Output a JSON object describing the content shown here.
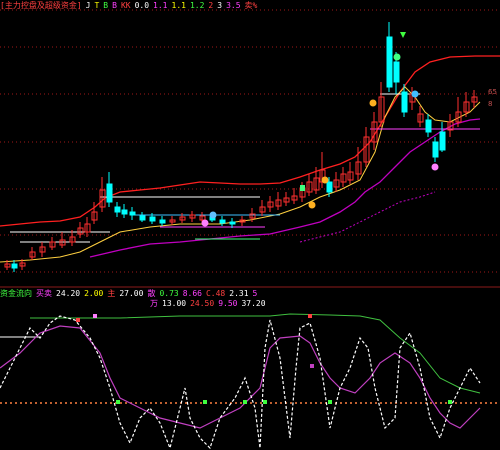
{
  "main_header": {
    "items": [
      {
        "text": "[主力控盘及超级资金]",
        "color": "#ff4040"
      },
      {
        "text": "J",
        "color": "#ffffff"
      },
      {
        "text": "T",
        "color": "#ffff00"
      },
      {
        "text": "B",
        "color": "#40ff40"
      },
      {
        "text": "B",
        "color": "#ff40ff"
      },
      {
        "text": "KK",
        "color": "#ff4040"
      },
      {
        "text": "0.0",
        "color": "#ffffff"
      },
      {
        "text": "1.1",
        "color": "#ff40ff"
      },
      {
        "text": "1.1",
        "color": "#ffff00"
      },
      {
        "text": "1.2",
        "color": "#40ff40"
      },
      {
        "text": "2",
        "color": "#ff4040"
      },
      {
        "text": "3",
        "color": "#ffffff"
      },
      {
        "text": "3.5",
        "color": "#ff40ff"
      },
      {
        "text": "卖%",
        "color": "#ff4040"
      }
    ]
  },
  "sub_header": {
    "items": [
      {
        "text": "资金流向",
        "color": "#40ff40"
      },
      {
        "text": "买卖",
        "color": "#ff40ff"
      },
      {
        "text": "24.20",
        "color": "#ffffff"
      },
      {
        "text": "2.00",
        "color": "#ffff00"
      },
      {
        "text": "主",
        "color": "#ff4040"
      },
      {
        "text": "27.00",
        "color": "#ffffff"
      },
      {
        "text": "散",
        "color": "#ff40ff"
      },
      {
        "text": "0.73",
        "color": "#40ff40"
      },
      {
        "text": "8.66",
        "color": "#ff40ff"
      },
      {
        "text": "C.48",
        "color": "#ff4040"
      },
      {
        "text": "2.31",
        "color": "#ffffff"
      },
      {
        "text": "5",
        "color": "#ff40ff"
      }
    ],
    "line2": [
      {
        "text": "万",
        "color": "#ff40ff"
      },
      {
        "text": "13.00",
        "color": "#ffffff"
      },
      {
        "text": "24.50",
        "color": "#ff4040"
      },
      {
        "text": "9.50",
        "color": "#ff40ff"
      },
      {
        "text": "37.20",
        "color": "#ffffff"
      }
    ]
  },
  "axis": {
    "top_labels": [
      "65",
      "8"
    ]
  },
  "colors": {
    "background": "#000000",
    "up_candle": "#ff3030",
    "down_candle": "#00ffff",
    "ma_red": "#ff2020",
    "ma_yellow": "#ffd040",
    "ma_purple": "#c000c0",
    "osc_white": "#ffffff",
    "osc_purple": "#c040c0",
    "osc_green": "#40c040",
    "dotted_orange": "#ff8040",
    "separator": "#8b1a1a"
  },
  "icons": [
    "bull-face-icon",
    "bear-face-icon",
    "star-icon",
    "arrow-down-icon"
  ]
}
